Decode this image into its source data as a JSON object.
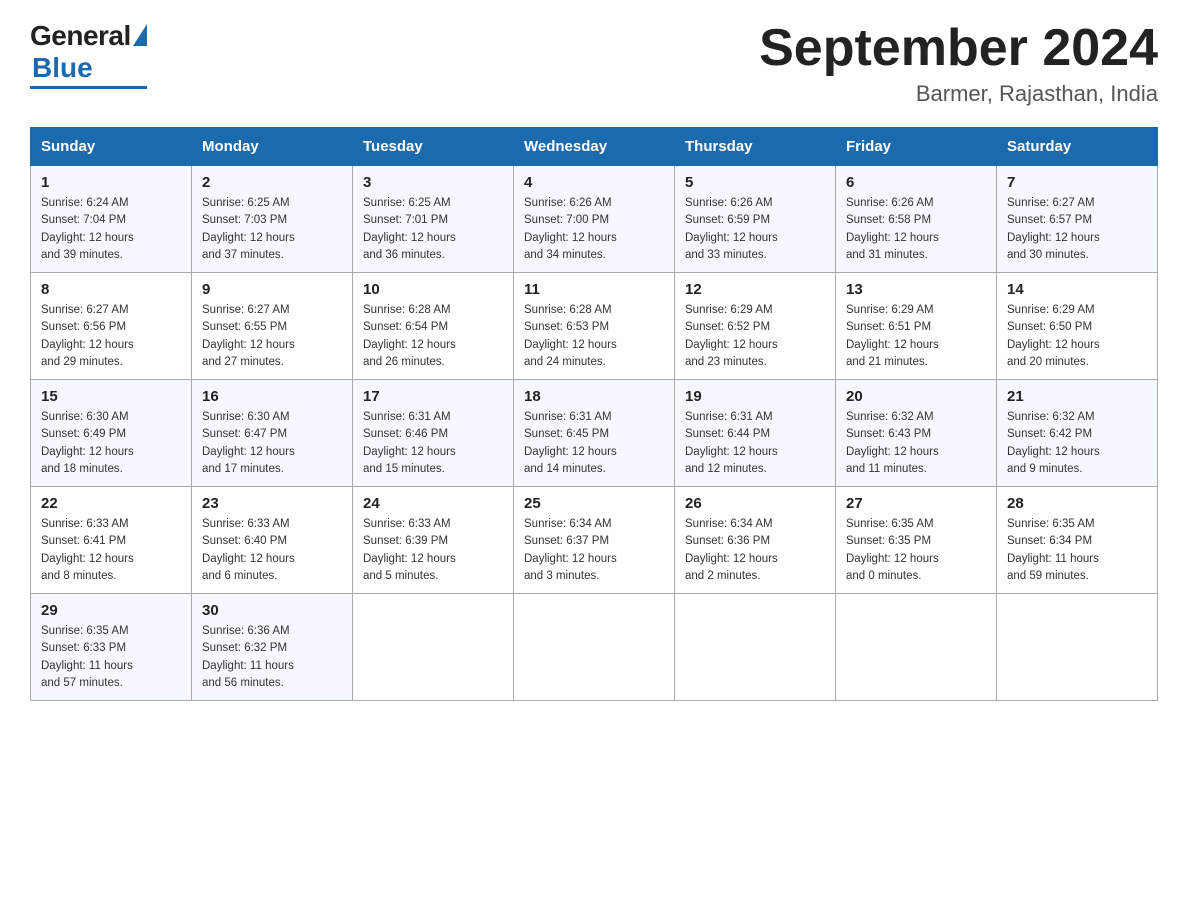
{
  "logo": {
    "general": "General",
    "blue": "Blue"
  },
  "header": {
    "title": "September 2024",
    "location": "Barmer, Rajasthan, India"
  },
  "days_header": [
    "Sunday",
    "Monday",
    "Tuesday",
    "Wednesday",
    "Thursday",
    "Friday",
    "Saturday"
  ],
  "weeks": [
    [
      {
        "day": "1",
        "sunrise": "6:24 AM",
        "sunset": "7:04 PM",
        "daylight": "12 hours and 39 minutes."
      },
      {
        "day": "2",
        "sunrise": "6:25 AM",
        "sunset": "7:03 PM",
        "daylight": "12 hours and 37 minutes."
      },
      {
        "day": "3",
        "sunrise": "6:25 AM",
        "sunset": "7:01 PM",
        "daylight": "12 hours and 36 minutes."
      },
      {
        "day": "4",
        "sunrise": "6:26 AM",
        "sunset": "7:00 PM",
        "daylight": "12 hours and 34 minutes."
      },
      {
        "day": "5",
        "sunrise": "6:26 AM",
        "sunset": "6:59 PM",
        "daylight": "12 hours and 33 minutes."
      },
      {
        "day": "6",
        "sunrise": "6:26 AM",
        "sunset": "6:58 PM",
        "daylight": "12 hours and 31 minutes."
      },
      {
        "day": "7",
        "sunrise": "6:27 AM",
        "sunset": "6:57 PM",
        "daylight": "12 hours and 30 minutes."
      }
    ],
    [
      {
        "day": "8",
        "sunrise": "6:27 AM",
        "sunset": "6:56 PM",
        "daylight": "12 hours and 29 minutes."
      },
      {
        "day": "9",
        "sunrise": "6:27 AM",
        "sunset": "6:55 PM",
        "daylight": "12 hours and 27 minutes."
      },
      {
        "day": "10",
        "sunrise": "6:28 AM",
        "sunset": "6:54 PM",
        "daylight": "12 hours and 26 minutes."
      },
      {
        "day": "11",
        "sunrise": "6:28 AM",
        "sunset": "6:53 PM",
        "daylight": "12 hours and 24 minutes."
      },
      {
        "day": "12",
        "sunrise": "6:29 AM",
        "sunset": "6:52 PM",
        "daylight": "12 hours and 23 minutes."
      },
      {
        "day": "13",
        "sunrise": "6:29 AM",
        "sunset": "6:51 PM",
        "daylight": "12 hours and 21 minutes."
      },
      {
        "day": "14",
        "sunrise": "6:29 AM",
        "sunset": "6:50 PM",
        "daylight": "12 hours and 20 minutes."
      }
    ],
    [
      {
        "day": "15",
        "sunrise": "6:30 AM",
        "sunset": "6:49 PM",
        "daylight": "12 hours and 18 minutes."
      },
      {
        "day": "16",
        "sunrise": "6:30 AM",
        "sunset": "6:47 PM",
        "daylight": "12 hours and 17 minutes."
      },
      {
        "day": "17",
        "sunrise": "6:31 AM",
        "sunset": "6:46 PM",
        "daylight": "12 hours and 15 minutes."
      },
      {
        "day": "18",
        "sunrise": "6:31 AM",
        "sunset": "6:45 PM",
        "daylight": "12 hours and 14 minutes."
      },
      {
        "day": "19",
        "sunrise": "6:31 AM",
        "sunset": "6:44 PM",
        "daylight": "12 hours and 12 minutes."
      },
      {
        "day": "20",
        "sunrise": "6:32 AM",
        "sunset": "6:43 PM",
        "daylight": "12 hours and 11 minutes."
      },
      {
        "day": "21",
        "sunrise": "6:32 AM",
        "sunset": "6:42 PM",
        "daylight": "12 hours and 9 minutes."
      }
    ],
    [
      {
        "day": "22",
        "sunrise": "6:33 AM",
        "sunset": "6:41 PM",
        "daylight": "12 hours and 8 minutes."
      },
      {
        "day": "23",
        "sunrise": "6:33 AM",
        "sunset": "6:40 PM",
        "daylight": "12 hours and 6 minutes."
      },
      {
        "day": "24",
        "sunrise": "6:33 AM",
        "sunset": "6:39 PM",
        "daylight": "12 hours and 5 minutes."
      },
      {
        "day": "25",
        "sunrise": "6:34 AM",
        "sunset": "6:37 PM",
        "daylight": "12 hours and 3 minutes."
      },
      {
        "day": "26",
        "sunrise": "6:34 AM",
        "sunset": "6:36 PM",
        "daylight": "12 hours and 2 minutes."
      },
      {
        "day": "27",
        "sunrise": "6:35 AM",
        "sunset": "6:35 PM",
        "daylight": "12 hours and 0 minutes."
      },
      {
        "day": "28",
        "sunrise": "6:35 AM",
        "sunset": "6:34 PM",
        "daylight": "11 hours and 59 minutes."
      }
    ],
    [
      {
        "day": "29",
        "sunrise": "6:35 AM",
        "sunset": "6:33 PM",
        "daylight": "11 hours and 57 minutes."
      },
      {
        "day": "30",
        "sunrise": "6:36 AM",
        "sunset": "6:32 PM",
        "daylight": "11 hours and 56 minutes."
      },
      null,
      null,
      null,
      null,
      null
    ]
  ],
  "labels": {
    "sunrise": "Sunrise:",
    "sunset": "Sunset:",
    "daylight": "Daylight:"
  }
}
